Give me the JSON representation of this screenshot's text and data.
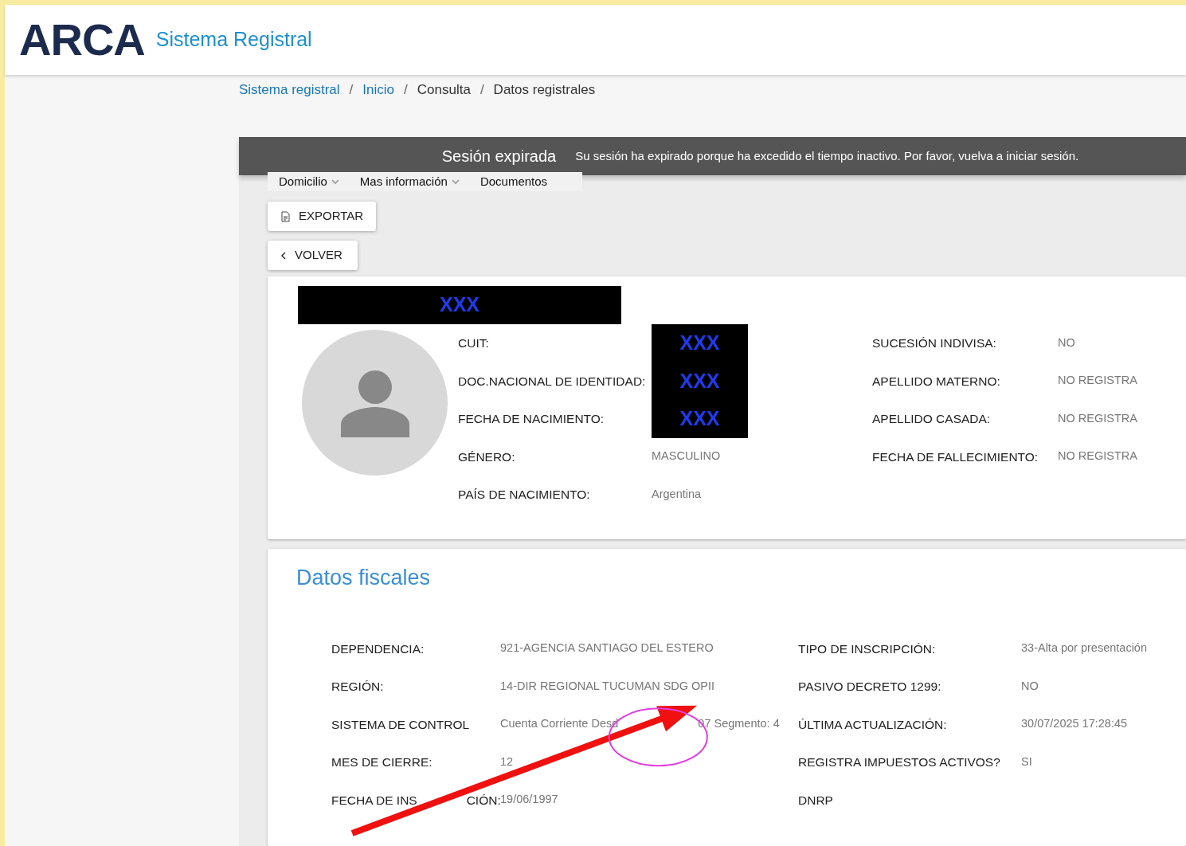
{
  "header": {
    "logo": "ARCA",
    "app_title": "Sistema Registral"
  },
  "breadcrumb": [
    {
      "label": "Sistema registral",
      "link": true
    },
    {
      "separator": "/",
      "label": "Inicio",
      "link": true
    },
    {
      "separator": "/",
      "label": "Consulta",
      "link": false
    },
    {
      "separator": "/",
      "label": "Datos registrales",
      "link": false
    }
  ],
  "session_banner": {
    "title": "Sesión expirada",
    "message": "Su sesión ha expirado porque ha excedido el tiempo inactivo. Por favor, vuelva a iniciar sesión."
  },
  "menu_tabs": [
    {
      "label": "Domicilio",
      "dropdown": true
    },
    {
      "label": "Mas información",
      "dropdown": true
    },
    {
      "label": "Documentos",
      "dropdown": false
    }
  ],
  "buttons": [
    {
      "label": "EXPORTAR",
      "kind": "export"
    },
    {
      "label": "VOLVER",
      "kind": "back"
    }
  ],
  "profile": {
    "name": "XXX",
    "fields_left": [
      {
        "label": "CUIT:",
        "value": "XXX",
        "redacted": true
      },
      {
        "label": "DOC.NACIONAL DE IDENTIDAD:",
        "value": "XXX",
        "redacted": true
      },
      {
        "label": "FECHA DE NACIMIENTO:",
        "value": "XXX",
        "redacted": true
      },
      {
        "label": "GÉNERO:",
        "value": "MASCULINO",
        "redacted": false
      },
      {
        "label": "PAÍS DE NACIMIENTO:",
        "value": "Argentina",
        "redacted": false
      }
    ],
    "fields_right": [
      {
        "label": "SUCESIÓN INDIVISA:",
        "value": "NO"
      },
      {
        "label": "APELLIDO MATERNO:",
        "value": "NO REGISTRA"
      },
      {
        "label": "APELLIDO CASADA:",
        "value": "NO REGISTRA"
      },
      {
        "label": "FECHA DE FALLECIMIENTO:",
        "value": "NO REGISTRA"
      }
    ]
  },
  "fiscal": {
    "title": "Datos fiscales",
    "fields_left": [
      {
        "label": "DEPENDENCIA:",
        "value": "921-AGENCIA SANTIAGO DEL ESTERO"
      },
      {
        "label": "REGIÓN:",
        "value": "14-DIR REGIONAL TUCUMAN SDG OPII"
      },
      {
        "label": "SISTEMA DE CONTROL",
        "value_parts": [
          "Cuenta Corriente Desd",
          "07 Segmento: 4"
        ]
      },
      {
        "label": "MES DE CIERRE:",
        "value": "12"
      },
      {
        "label_parts": [
          "FECHA DE INS",
          "CIÓN:"
        ],
        "value": "19/06/1997"
      }
    ],
    "fields_right": [
      {
        "label": "TIPO DE INSCRIPCIÓN:",
        "value": "33-Alta por presentación"
      },
      {
        "label": "PASIVO DECRETO 1299:",
        "value": "NO"
      },
      {
        "label": "ÚLTIMA ACTUALIZACIÓN:",
        "value": "30/07/2025 17:28:45"
      },
      {
        "label": "REGISTRA IMPUESTOS ACTIVOS?",
        "value": "SI"
      },
      {
        "label": "DNRP"
      }
    ]
  }
}
